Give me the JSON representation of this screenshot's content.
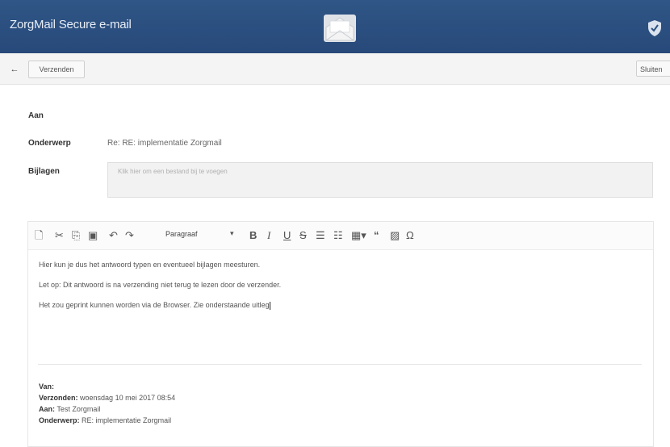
{
  "header": {
    "title": "ZorgMail Secure e-mail",
    "logo_icon": "envelope-icon",
    "secure_icon": "shield-check-icon",
    "bg_color": "#2b5080"
  },
  "toolbar": {
    "back_label": "←",
    "send_label": "Verzenden",
    "close_label": "Sluiten"
  },
  "form": {
    "to_label": "Aan",
    "to_value": "",
    "subject_label": "Onderwerp",
    "subject_value": "Re: RE: implementatie Zorgmail",
    "attachments_label": "Bijlagen",
    "attachments_placeholder": "Klik hier om een bestand bij te voegen"
  },
  "editor": {
    "format_select": "Paragraaf",
    "tools": [
      "new-document-icon",
      "cut-icon",
      "copy-icon",
      "paste-icon",
      "undo-icon",
      "redo-icon",
      "bold-icon",
      "italic-icon",
      "underline-icon",
      "strikethrough-icon",
      "bullet-list-icon",
      "numbered-list-icon",
      "table-icon",
      "blockquote-icon",
      "image-icon",
      "special-character-icon"
    ],
    "body_lines": [
      "Hier kun je dus het antwoord typen en eventueel bijlagen meesturen.",
      "Let op: Dit antwoord is na verzending niet terug te lezen door de verzender.",
      "Het zou geprint kunnen worden via de Browser. Zie onderstaande uitleg"
    ],
    "quote": {
      "from_label": "Van:",
      "from_value": "",
      "sent_label": "Verzonden:",
      "sent_value": "woensdag 10 mei 2017 08:54",
      "to_label": "Aan:",
      "to_value": "Test Zorgmail",
      "subject_label": "Onderwerp:",
      "subject_value": "RE: implementatie Zorgmail"
    }
  }
}
